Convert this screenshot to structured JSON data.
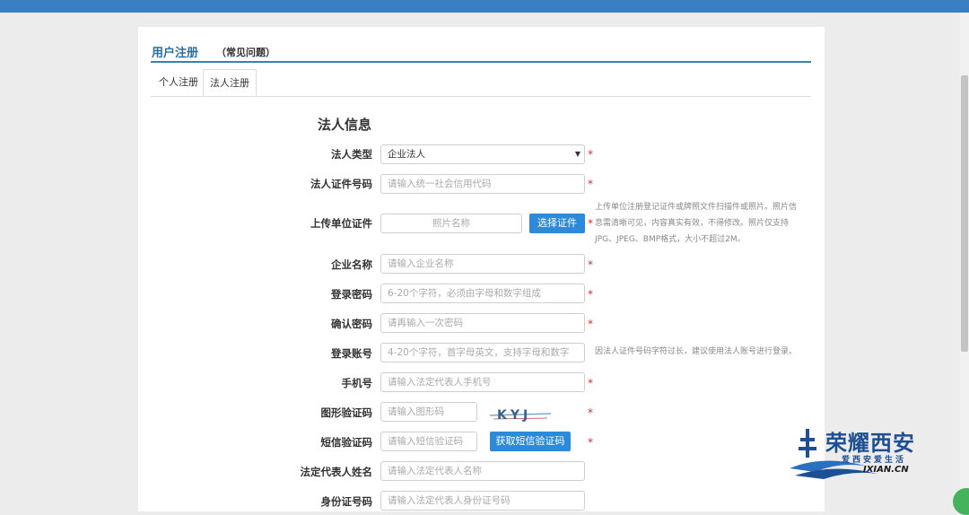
{
  "header": {
    "title": "用户注册",
    "faq_link": "（常见问题）"
  },
  "tabs": [
    {
      "label": "个人注册"
    },
    {
      "label": "法人注册"
    }
  ],
  "section_title": "法人信息",
  "form": {
    "legal_type": {
      "label": "法人类型",
      "value": "企业法人"
    },
    "cert_number": {
      "label": "法人证件号码",
      "placeholder": "请输入统一社会信用代码"
    },
    "upload": {
      "label": "上传单位证件",
      "file_placeholder": "照片名称",
      "button": "选择证件",
      "hint_lines": [
        "上传单位注册登记证件或牌照文件扫描件或照片。照片信",
        "息需清晰可见，内容真实有效，不得修改。照片仅支持",
        "JPG、JPEG、BMP格式，大小不超过2M。"
      ]
    },
    "company_name": {
      "label": "企业名称",
      "placeholder": "请输入企业名称"
    },
    "password": {
      "label": "登录密码",
      "placeholder": "6-20个字符，必须由字母和数字组成"
    },
    "confirm_password": {
      "label": "确认密码",
      "placeholder": "请再输入一次密码"
    },
    "account": {
      "label": "登录账号",
      "placeholder": "4-20个字符，首字母英文，支持字母和数字",
      "hint": "因法人证件号码字符过长，建议使用法人账号进行登录。"
    },
    "phone": {
      "label": "手机号",
      "placeholder": "请输入法定代表人手机号"
    },
    "image_code": {
      "label": "图形验证码",
      "placeholder": "请输入图形码",
      "captcha_text": "KYJ"
    },
    "sms_code": {
      "label": "短信验证码",
      "placeholder": "请输入短信验证码",
      "button": "获取短信验证码"
    },
    "rep_name": {
      "label": "法定代表人姓名",
      "placeholder": "请输入法定代表人名称"
    },
    "id_number": {
      "label": "身份证号码",
      "placeholder": "请输入法定代表人身份证号码"
    }
  },
  "required_mark": "*",
  "watermark": {
    "title": "荣耀西安",
    "subtitle": "爱西安爱生活",
    "url": "IXIAN.CN"
  }
}
